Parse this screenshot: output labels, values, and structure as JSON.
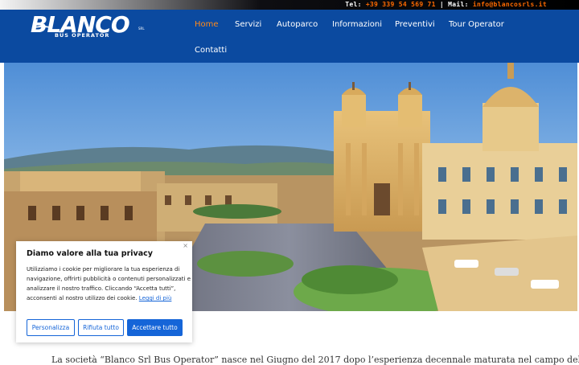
{
  "topbar": {
    "tel_label": "Tel:",
    "tel_value": "+39 339 54 569 71",
    "separator": "|",
    "mail_label": "Mail:",
    "mail_value": "info@blancosrls.it"
  },
  "logo": {
    "main": "BLANCO",
    "tiny": "SRL",
    "sub": "BUS OPERATOR"
  },
  "nav": {
    "items": [
      "Home",
      "Servizi",
      "Autoparco",
      "Informazioni",
      "Preventivi",
      "Tour Operator",
      "Contatti"
    ],
    "active": "Home"
  },
  "cookie": {
    "close": "×",
    "title": "Diamo valore alla tua privacy",
    "body": "Utilizziamo i cookie per migliorare la tua esperienza di navigazione, offrirti pubblicità o contenuti personalizzati e analizzare il nostro traffico. Cliccando “Accetta tutti”, acconsenti al nostro utilizzo dei cookie.",
    "link": "Leggi di più",
    "btn_customize": "Personalizza",
    "btn_reject": "Rifiuta tutto",
    "btn_accept": "Accettare tutto"
  },
  "content": {
    "intro": "La società “Blanco Srl Bus Operator” nasce nel Giugno del 2017 dopo l’esperienza decennale maturata nel campo del"
  },
  "colors": {
    "header_bg": "#0b4aa0",
    "accent_orange": "#ff6a00",
    "nav_active": "#ff8a1a",
    "button_blue": "#1565d8"
  }
}
